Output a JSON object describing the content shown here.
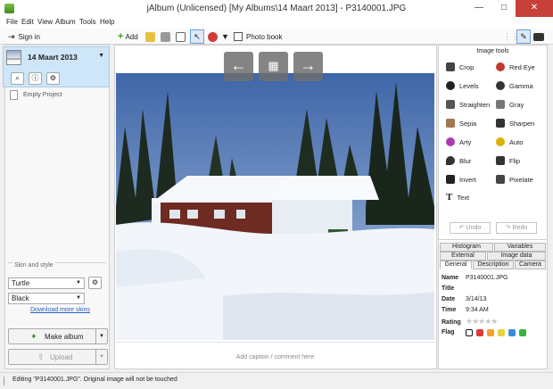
{
  "window": {
    "title": "jAlbum (Unlicensed) [My Albums\\14 Maart 2013] - P3140001.JPG",
    "minimize": "—",
    "maximize": "□",
    "close": "✕"
  },
  "menu": [
    "File",
    "Edit",
    "View",
    "Album",
    "Tools",
    "Help"
  ],
  "toolbar": {
    "add": "Add",
    "photo_book": "Photo book"
  },
  "left": {
    "sign_in": "Sign in",
    "album_name": "14 Maart 2013",
    "empty_project": "Empty Project",
    "skin_section": "Skin and style",
    "skin_value": "Turtle",
    "style_value": "Black",
    "download_skins": "Download more skins",
    "make_album": "Make album",
    "upload": "Upload"
  },
  "center": {
    "caption_placeholder": "Add caption / comment here"
  },
  "right": {
    "image_tools_title": "Image tools",
    "tools": [
      {
        "label": "Crop",
        "icon": "crop-icon",
        "color": "#444444"
      },
      {
        "label": "Red Eye",
        "icon": "red-eye-icon",
        "color": "#c0392b"
      },
      {
        "label": "Levels",
        "icon": "levels-icon",
        "color": "#222222"
      },
      {
        "label": "Gamma",
        "icon": "gamma-icon",
        "color": "#333333"
      },
      {
        "label": "Straighten",
        "icon": "straighten-icon",
        "color": "#555555"
      },
      {
        "label": "Gray",
        "icon": "gray-icon",
        "color": "#777777"
      },
      {
        "label": "Sepia",
        "icon": "sepia-icon",
        "color": "#a07850"
      },
      {
        "label": "Sharpen",
        "icon": "sharpen-icon",
        "color": "#333333"
      },
      {
        "label": "Arty",
        "icon": "arty-icon",
        "color": "#b03ab0"
      },
      {
        "label": "Auto",
        "icon": "auto-icon",
        "color": "#e0b000"
      },
      {
        "label": "Blur",
        "icon": "blur-icon",
        "color": "#333333"
      },
      {
        "label": "Flip",
        "icon": "flip-icon",
        "color": "#333333"
      },
      {
        "label": "Invert",
        "icon": "invert-icon",
        "color": "#222222"
      },
      {
        "label": "Pixelate",
        "icon": "pixelate-icon",
        "color": "#444444"
      },
      {
        "label": "Text",
        "icon": "text-icon",
        "color": "#222222"
      }
    ],
    "undo": "Undo",
    "redo": "Redo",
    "tabs_row1": [
      "Histogram",
      "Variables"
    ],
    "tabs_row2": [
      "External",
      "Image data"
    ],
    "tabs_row3": [
      "General",
      "Description",
      "Camera"
    ],
    "props": {
      "name_label": "Name",
      "name_value": "P3140001.JPG",
      "title_label": "Title",
      "title_value": "",
      "date_label": "Date",
      "date_value": "3/14/13",
      "time_label": "Time",
      "time_value": "9:34 AM",
      "rating_label": "Rating",
      "flag_label": "Flag"
    },
    "flag_colors": [
      "#ffffff",
      "#e03a3a",
      "#f0a030",
      "#e8d040",
      "#3a8ae0",
      "#3ab040"
    ]
  },
  "status": {
    "text": "Editing \"P3140001.JPG\". Original image will not be touched"
  }
}
